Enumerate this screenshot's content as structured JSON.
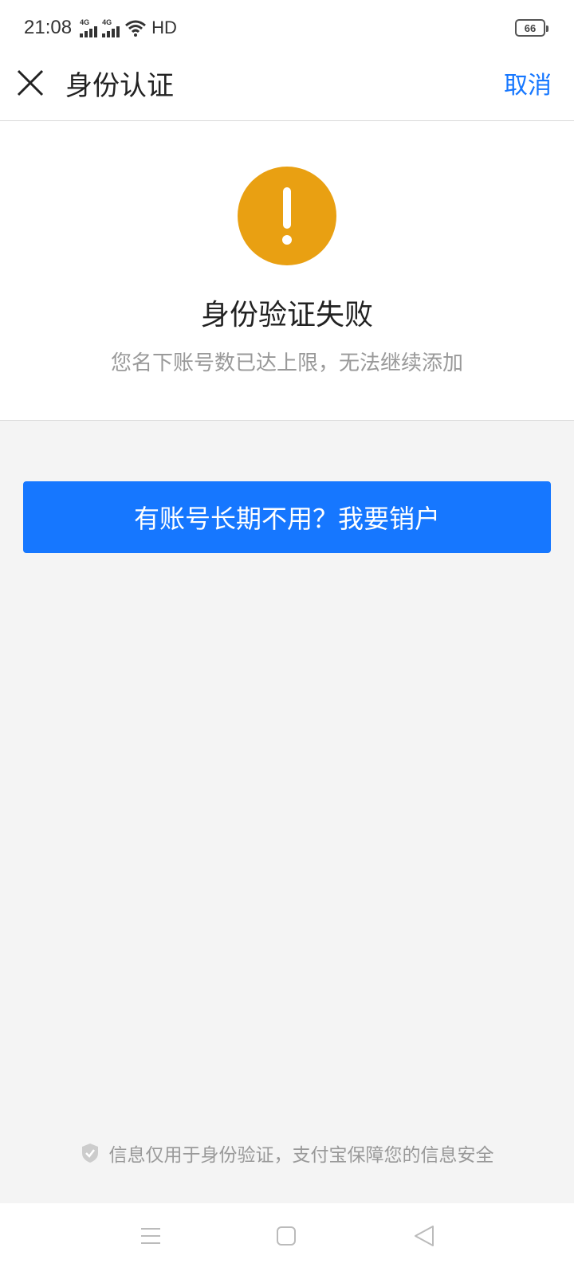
{
  "status_bar": {
    "time": "21:08",
    "signal1_label": "4G",
    "signal2_label": "4G",
    "hd_label": "HD",
    "battery": "66"
  },
  "header": {
    "title": "身份认证",
    "cancel_label": "取消"
  },
  "result": {
    "icon": "warning-icon",
    "icon_color": "#e9a012",
    "title": "身份验证失败",
    "subtitle": "您名下账号数已达上限，无法继续添加"
  },
  "primary_button": {
    "label": "有账号长期不用？我要销户",
    "color": "#1677ff"
  },
  "footer": {
    "security_note": "信息仅用于身份验证，支付宝保障您的信息安全"
  },
  "nav": {
    "menu_icon": "menu-icon",
    "home_icon": "home-icon",
    "back_icon": "back-icon"
  },
  "colors": {
    "accent": "#1677ff",
    "warning": "#e9a012",
    "background": "#f4f4f4"
  }
}
